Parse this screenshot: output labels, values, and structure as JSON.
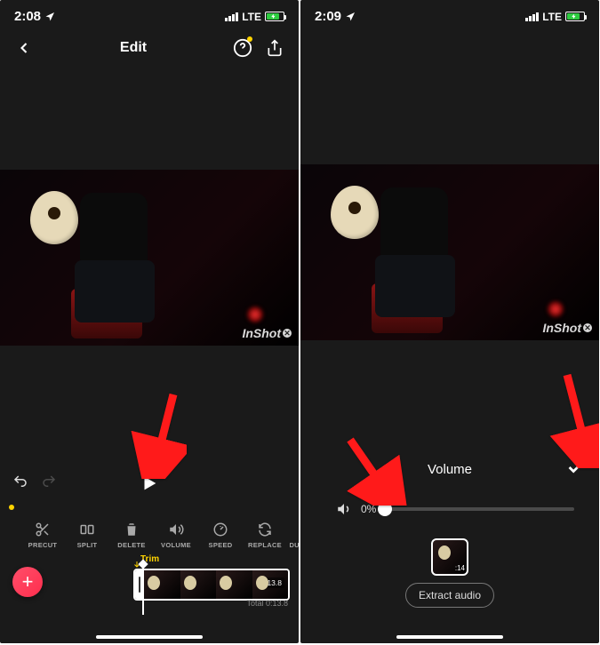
{
  "screen1": {
    "statusbar": {
      "time": "2:08",
      "network": "LTE"
    },
    "topbar": {
      "title": "Edit"
    },
    "watermark": "InShot",
    "toolbar": {
      "items": [
        {
          "label": "PRECUT"
        },
        {
          "label": "SPLIT"
        },
        {
          "label": "DELETE"
        },
        {
          "label": "VOLUME"
        },
        {
          "label": "SPEED"
        },
        {
          "label": "REPLACE"
        },
        {
          "label": "DUPLICATE"
        }
      ]
    },
    "timeline": {
      "trim_label": "Trim",
      "clip_duration": ":13.8",
      "total_label": "Total 0:13.8"
    },
    "fab": "+"
  },
  "screen2": {
    "statusbar": {
      "time": "2:09",
      "network": "LTE"
    },
    "watermark": "InShot",
    "volume": {
      "title": "Volume",
      "percent_label": "0%",
      "percent": 0
    },
    "clip_preview_duration": ":14",
    "extract_label": "Extract audio"
  }
}
